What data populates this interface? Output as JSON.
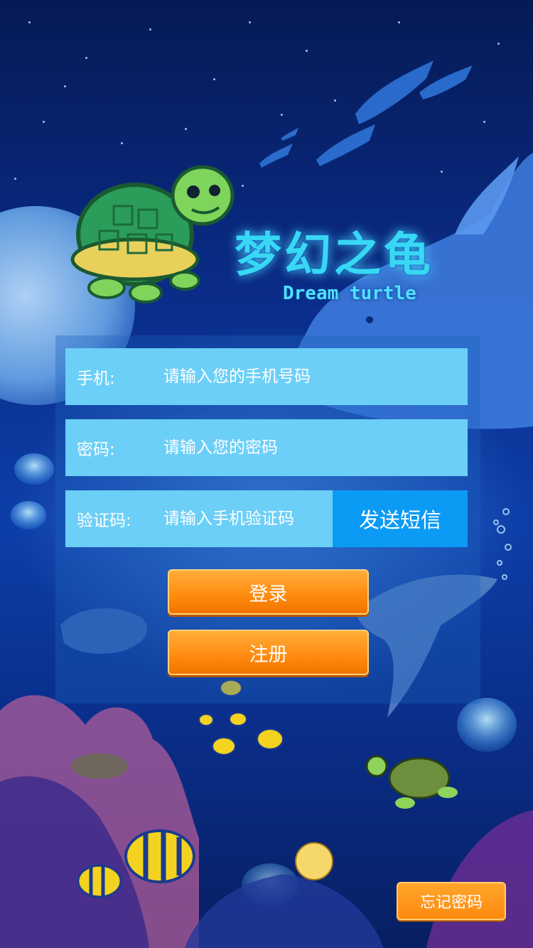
{
  "logo": {
    "title": "梦幻之龟",
    "subtitle": "Dream turtle"
  },
  "form": {
    "phone": {
      "label": "手机:",
      "placeholder": "请输入您的手机号码"
    },
    "password": {
      "label": "密码:",
      "placeholder": "请输入您的密码"
    },
    "code": {
      "label": "验证码:",
      "placeholder": "请输入手机验证码",
      "send_label": "发送短信"
    }
  },
  "actions": {
    "login_label": "登录",
    "register_label": "注册",
    "forgot_label": "忘记密码"
  },
  "colors": {
    "field_bg": "#6ccff7",
    "send_button_bg": "#0b9bf4",
    "action_orange": "#ff8a0f",
    "title_cyan": "#38d8f4"
  }
}
